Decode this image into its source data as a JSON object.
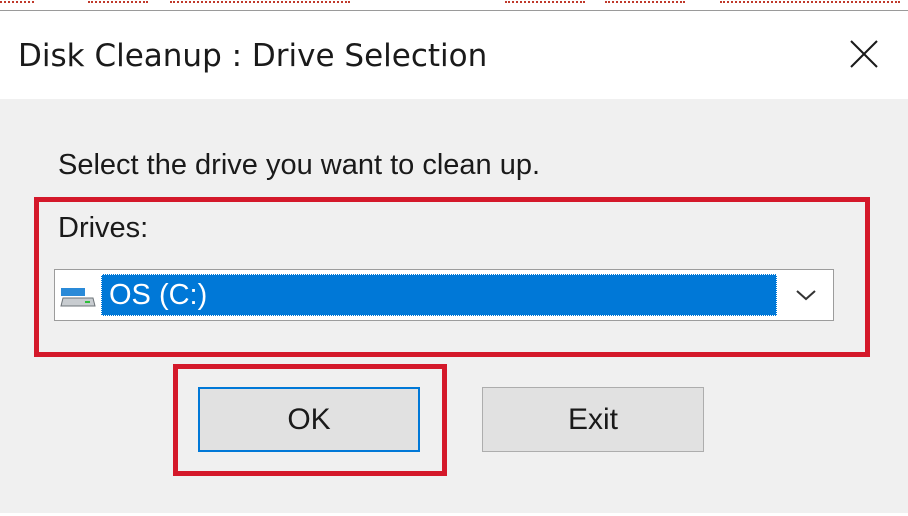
{
  "window": {
    "title": "Disk Cleanup : Drive Selection",
    "close_icon": "close-icon"
  },
  "dialog": {
    "prompt": "Select the drive you want to clean up.",
    "drives_label": "Drives:",
    "selected_drive": "OS (C:)",
    "drive_icon": "hard-drive-icon",
    "dropdown_icon": "chevron-down-icon"
  },
  "buttons": {
    "ok_label": "OK",
    "exit_label": "Exit"
  },
  "colors": {
    "selection": "#0078d7",
    "highlight_annotation": "#d4182a",
    "dialog_background": "#f0f0f0"
  }
}
